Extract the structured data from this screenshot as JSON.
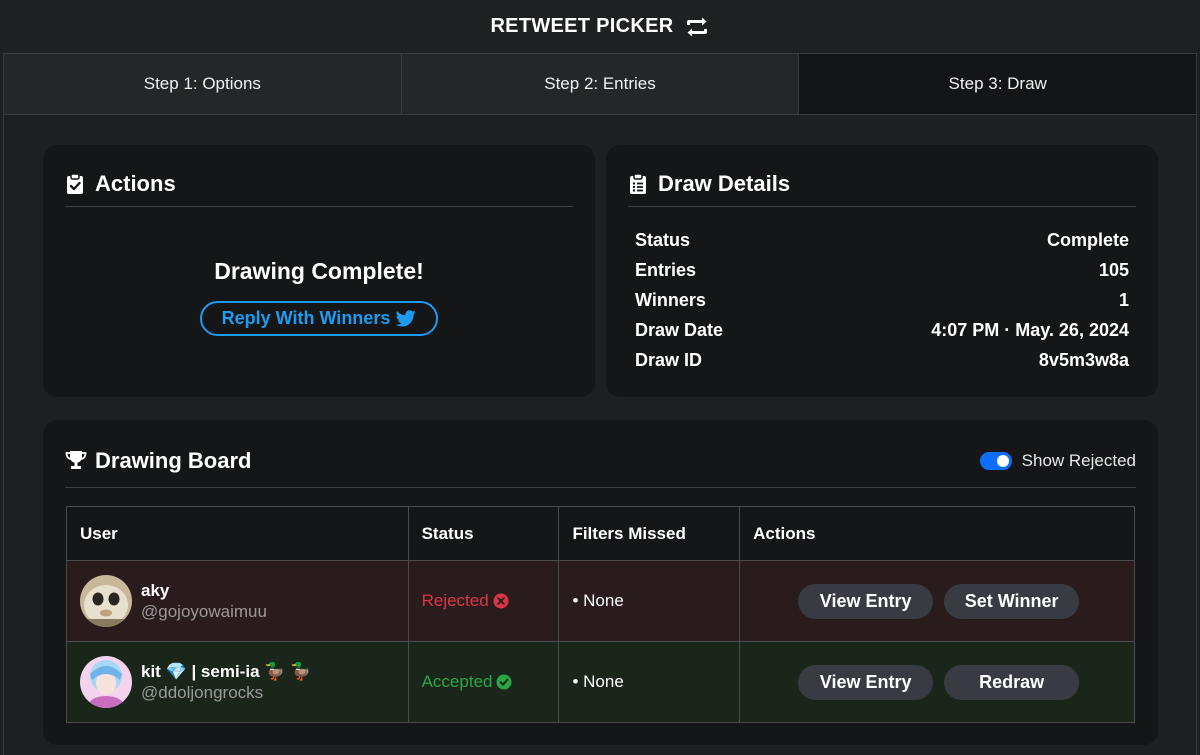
{
  "app": {
    "title": "RETWEET PICKER"
  },
  "tabs": [
    {
      "label": "Step 1: Options",
      "active": false
    },
    {
      "label": "Step 2: Entries",
      "active": false
    },
    {
      "label": "Step 3: Draw",
      "active": true
    }
  ],
  "actions_card": {
    "title": "Actions",
    "message": "Drawing Complete!",
    "reply_button_label": "Reply With Winners"
  },
  "details_card": {
    "title": "Draw Details",
    "rows": [
      {
        "label": "Status",
        "value": "Complete"
      },
      {
        "label": "Entries",
        "value": "105"
      },
      {
        "label": "Winners",
        "value": "1"
      },
      {
        "label": "Draw Date",
        "value": "4:07 PM · May. 26, 2024"
      },
      {
        "label": "Draw ID",
        "value": "8v5m3w8a"
      }
    ]
  },
  "board": {
    "title": "Drawing Board",
    "show_rejected_label": "Show Rejected",
    "show_rejected_on": true,
    "columns": [
      "User",
      "Status",
      "Filters Missed",
      "Actions"
    ],
    "rows": [
      {
        "name": "aky",
        "handle": "@gojoyowaimuu",
        "status": "Rejected",
        "filters": "• None",
        "view_label": "View Entry",
        "secondary_label": "Set Winner"
      },
      {
        "name": "kit 💎 | semi-ia 🦆 🦆",
        "handle": "@ddoljongrocks",
        "status": "Accepted",
        "filters": "• None",
        "view_label": "View Entry",
        "secondary_label": "Redraw"
      }
    ]
  },
  "colors": {
    "accent_blue": "#1d9bf0",
    "rejected_red": "#dc3545",
    "accepted_green": "#28a745",
    "toggle_blue": "#0d6efd"
  }
}
